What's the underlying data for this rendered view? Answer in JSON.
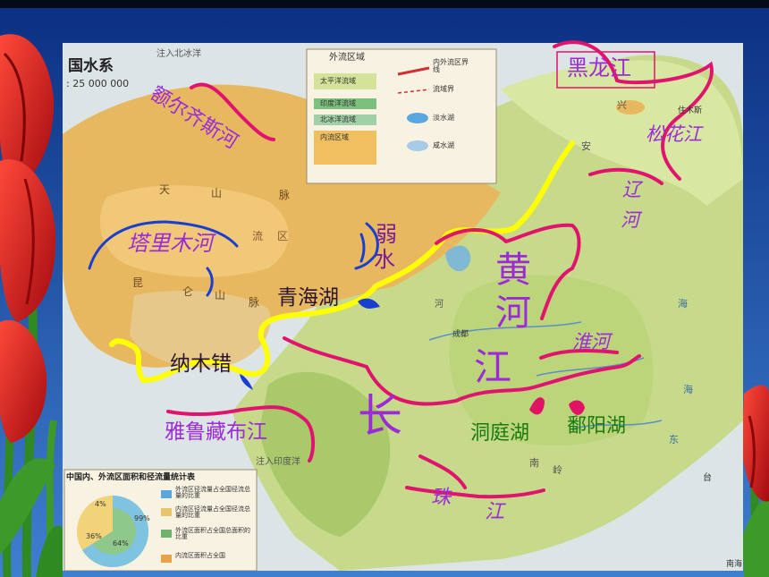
{
  "slide": {
    "colors": {
      "sky_top": "#0b2f82",
      "sky_bottom": "#3f7fd0",
      "tulip_red": "#d8161b",
      "stem_green": "#2f8a21",
      "map_paper": "#f4ecd6",
      "interior_basin": "#e8b860",
      "exterior_basin": "#c7d98a",
      "river_magenta": "#e0146e",
      "divide_yellow": "#ffff00",
      "lake_blue": "#1a3fd0",
      "lake_pink": "#e01465",
      "label_purple": "#9b2bd6",
      "label_green": "#1a7a10",
      "label_dark": "#2a1430"
    }
  },
  "map": {
    "title": "国水系",
    "scale": ": 25 000 000",
    "note_top": "注入北冰洋",
    "note_bottom": "注入印度洋",
    "note_corner": "南海",
    "legend": {
      "header": "外流区域",
      "items": [
        "太平洋流域",
        "印度洋流域",
        "北冰洋流域",
        "内流区域"
      ],
      "lines": [
        "内外流区界线",
        "流域界"
      ],
      "lakes": [
        "淡水湖",
        "咸水湖"
      ]
    },
    "stats": {
      "title": "中国内、外流区面积和径流量统计表",
      "pie_labels": [
        "4%",
        "99%",
        "36%",
        "64%"
      ],
      "rows": [
        "外流区径流量占全国径流总量的比重",
        "内流区径流量占全国径流总量的比重",
        "外流区面积占全国总面积的比重",
        "内流区面积占全国"
      ]
    },
    "base_text": [
      "天",
      "山",
      "脉",
      "流",
      "区",
      "昆",
      "仑",
      "山",
      "脉",
      "兴",
      "安",
      "住木斯",
      "成都",
      "南",
      "岭",
      "东",
      "海",
      "河",
      "海",
      "台"
    ]
  },
  "annotations": {
    "rivers": {
      "ertix": "额尔齐斯河",
      "tarim": "塔里木河",
      "ruoshui_1": "弱",
      "ruoshui_2": "水",
      "heilong": "黑龙江",
      "songhua": "松花江",
      "liao_1": "辽",
      "liao_2": "河",
      "huang_1": "黄",
      "huang_2": "河",
      "huai": "淮河",
      "chang_1": "长",
      "chang_2": "江",
      "yarlung": "雅鲁藏布江",
      "zhu_1": "珠",
      "zhu_2": "江"
    },
    "lakes": {
      "qinghai": "青海湖",
      "namtso": "纳木错",
      "dongting": "洞庭湖",
      "poyang": "鄱阳湖"
    }
  }
}
